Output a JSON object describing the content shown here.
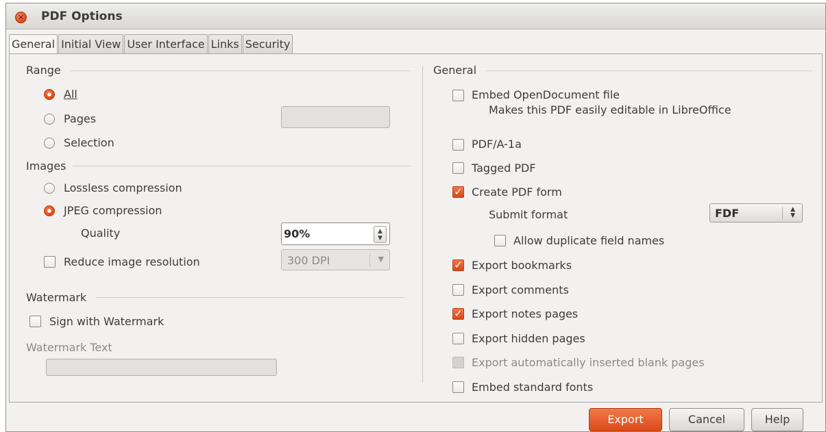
{
  "window": {
    "title": "PDF Options",
    "close_icon": "close-icon"
  },
  "tabs": [
    {
      "label": "General",
      "active": true
    },
    {
      "label": "Initial View"
    },
    {
      "label": "User Interface"
    },
    {
      "label": "Links"
    },
    {
      "label": "Security"
    }
  ],
  "range": {
    "heading": "Range",
    "all": {
      "label": "All",
      "selected": true
    },
    "pages": {
      "label": "Pages",
      "value": ""
    },
    "selection": {
      "label": "Selection"
    }
  },
  "images": {
    "heading": "Images",
    "lossless": {
      "label": "Lossless compression"
    },
    "jpeg": {
      "label": "JPEG compression",
      "selected": true
    },
    "quality": {
      "label": "Quality",
      "value": "90%"
    },
    "reduce": {
      "label": "Reduce image resolution",
      "checked": false,
      "value": "300 DPI"
    }
  },
  "watermark": {
    "heading": "Watermark",
    "sign": {
      "label": "Sign with Watermark",
      "checked": false
    },
    "text_label": "Watermark Text",
    "text_value": ""
  },
  "general": {
    "heading": "General",
    "embed_odf": {
      "label": "Embed OpenDocument file",
      "hint": "Makes this PDF easily editable in LibreOffice",
      "checked": false
    },
    "pdfa": {
      "label": "PDF/A-1a",
      "checked": false
    },
    "tagged": {
      "label": "Tagged PDF",
      "checked": false
    },
    "create_form": {
      "label": "Create PDF form",
      "checked": true
    },
    "submit_format": {
      "label": "Submit format",
      "value": "FDF"
    },
    "allow_dup": {
      "label": "Allow duplicate field names",
      "checked": false
    },
    "bookmarks": {
      "label": "Export bookmarks",
      "checked": true
    },
    "comments": {
      "label": "Export comments",
      "checked": false
    },
    "notes": {
      "label": "Export notes pages",
      "checked": true
    },
    "hidden": {
      "label": "Export hidden pages",
      "checked": false
    },
    "blank": {
      "label": "Export automatically inserted blank pages",
      "checked": false,
      "disabled": true
    },
    "fonts": {
      "label": "Embed standard fonts",
      "checked": false
    }
  },
  "buttons": {
    "export": "Export",
    "cancel": "Cancel",
    "help": "Help"
  },
  "colors": {
    "accent": "#dd4814",
    "background": "#f2f1f0"
  }
}
